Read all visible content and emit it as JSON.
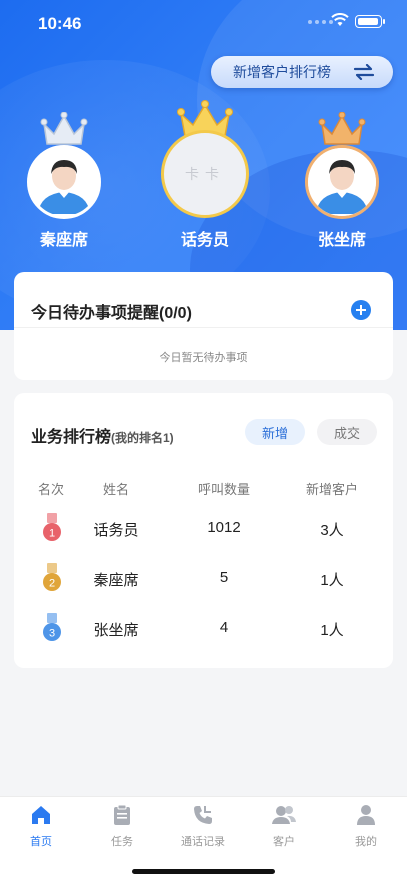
{
  "status_bar": {
    "time": "10:46"
  },
  "header": {
    "ranking_button_label": "新增客户排行榜"
  },
  "podium": [
    {
      "name": "秦座席",
      "place": 2
    },
    {
      "name": "话务员",
      "place": 1,
      "avatar_text": "卡卡"
    },
    {
      "name": "张坐席",
      "place": 3
    }
  ],
  "todo": {
    "title": "今日待办事项提醒(0/0)",
    "empty_text": "今日暂无待办事项"
  },
  "leaderboard": {
    "title": "业务排行榜",
    "my_rank": "(我的排名1)",
    "tabs": [
      {
        "label": "新增",
        "active": true
      },
      {
        "label": "成交",
        "active": false
      }
    ],
    "columns": [
      "名次",
      "姓名",
      "呼叫数量",
      "新增客户"
    ],
    "rows": [
      {
        "rank": "1",
        "name": "话务员",
        "calls": "1012",
        "new_customers": "3人",
        "medal_color": "#e8626a"
      },
      {
        "rank": "2",
        "name": "秦座席",
        "calls": "5",
        "new_customers": "1人",
        "medal_color": "#e0a53a"
      },
      {
        "rank": "3",
        "name": "张坐席",
        "calls": "4",
        "new_customers": "1人",
        "medal_color": "#4e95e8"
      }
    ]
  },
  "tabbar": [
    {
      "label": "首页",
      "icon": "home-icon",
      "active": true
    },
    {
      "label": "任务",
      "icon": "clipboard-icon",
      "active": false
    },
    {
      "label": "通话记录",
      "icon": "phone-icon",
      "active": false
    },
    {
      "label": "客户",
      "icon": "users-icon",
      "active": false
    },
    {
      "label": "我的",
      "icon": "person-icon",
      "active": false
    }
  ],
  "colors": {
    "primary": "#2b7af0",
    "gold": "#f3c94a",
    "silver": "#c9d4e4",
    "bronze": "#e8a04a"
  }
}
